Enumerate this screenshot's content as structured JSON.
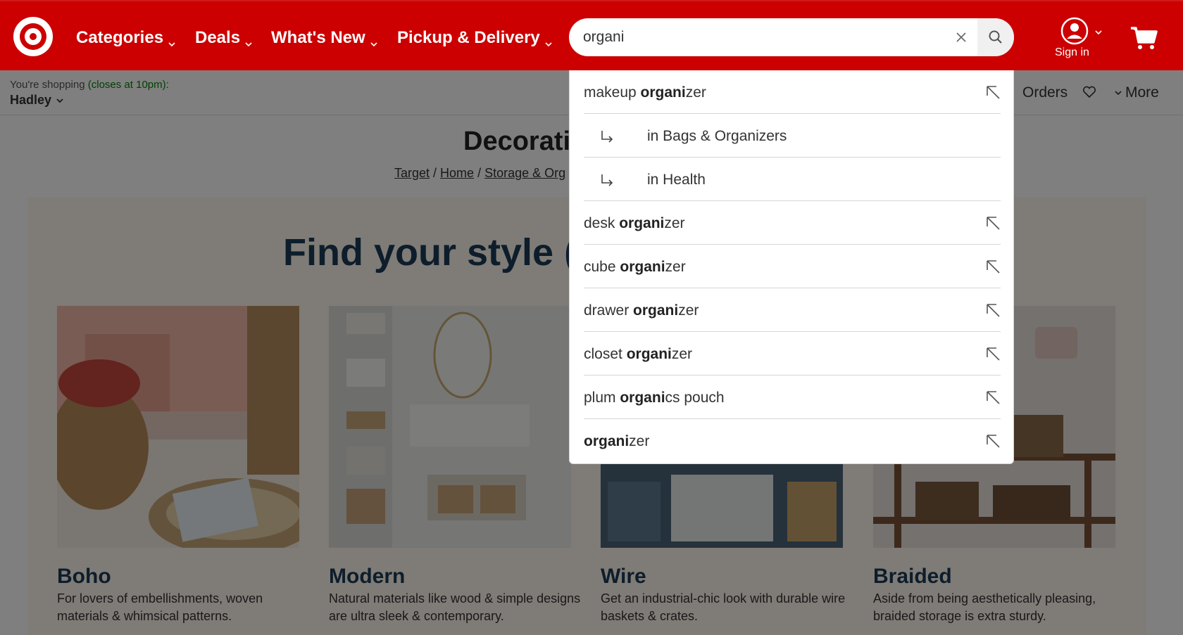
{
  "header": {
    "nav": [
      "Categories",
      "Deals",
      "What's New",
      "Pickup & Delivery"
    ],
    "search_value": "organi",
    "signin_label": "Sign in"
  },
  "subbar": {
    "shopping_prefix": "You're shopping ",
    "shopping_hours": "(closes at 10pm):",
    "store_name": "Hadley",
    "orders_label": "Orders",
    "more_label": "More"
  },
  "page": {
    "title": "Decorati",
    "breadcrumb": [
      "Target",
      "Home",
      "Storage & Org"
    ],
    "breadcrumb_sep": " / ",
    "style_title": "Find your style (",
    "cards": [
      {
        "name": "Boho",
        "desc": "For lovers of embellishments, woven materials & whimsical patterns."
      },
      {
        "name": "Modern",
        "desc": "Natural materials like wood & simple designs are ultra sleek & contemporary."
      },
      {
        "name": "Wire",
        "desc": "Get an industrial-chic look with durable wire baskets & crates."
      },
      {
        "name": "Braided",
        "desc": "Aside from being aesthetically pleasing, braided storage is extra sturdy."
      }
    ]
  },
  "suggestions": [
    {
      "pre": "makeup ",
      "bold": "organi",
      "post": "zer",
      "type": "term"
    },
    {
      "text": "in Bags & Organizers",
      "type": "sub"
    },
    {
      "text": "in Health",
      "type": "sub"
    },
    {
      "pre": "desk ",
      "bold": "organi",
      "post": "zer",
      "type": "term"
    },
    {
      "pre": "cube ",
      "bold": "organi",
      "post": "zer",
      "type": "term"
    },
    {
      "pre": "drawer ",
      "bold": "organi",
      "post": "zer",
      "type": "term"
    },
    {
      "pre": "closet ",
      "bold": "organi",
      "post": "zer",
      "type": "term"
    },
    {
      "pre": "plum ",
      "bold": "organi",
      "post": "cs pouch",
      "type": "term"
    },
    {
      "pre": "",
      "bold": "organi",
      "post": "zer",
      "type": "term"
    }
  ],
  "colors": {
    "brand_red": "#cc0000",
    "style_navy": "#1b3a57",
    "panel_bg": "#fff7ec",
    "hours_green": "#008300"
  },
  "icons": [
    "target-logo-icon",
    "chevron-down-icon",
    "clear-icon",
    "search-icon",
    "account-icon",
    "cart-icon",
    "heart-icon",
    "return-arrow-icon",
    "fill-arrow-icon"
  ]
}
